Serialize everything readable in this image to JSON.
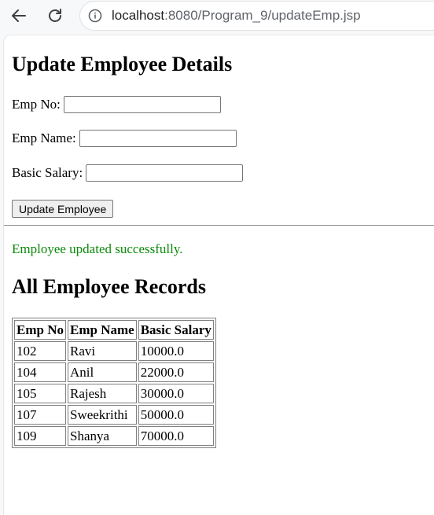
{
  "browser": {
    "url_host": "localhost",
    "url_rest": ":8080/Program_9/updateEmp.jsp"
  },
  "page": {
    "title": "Update Employee Details",
    "form": {
      "empno_label": "Emp No:",
      "empno_value": "",
      "empname_label": "Emp Name:",
      "empname_value": "",
      "salary_label": "Basic Salary:",
      "salary_value": "",
      "submit_label": "Update Employee"
    },
    "message": "Employee updated successfully.",
    "message_color": "#0a8a0a",
    "records_title": "All Employee Records",
    "table": {
      "headers": [
        "Emp No",
        "Emp Name",
        "Basic Salary"
      ],
      "rows": [
        [
          "102",
          "Ravi",
          "10000.0"
        ],
        [
          "104",
          "Anil",
          "22000.0"
        ],
        [
          "105",
          "Rajesh",
          "30000.0"
        ],
        [
          "107",
          "Sweekrithi",
          "50000.0"
        ],
        [
          "109",
          "Shanya",
          "70000.0"
        ]
      ]
    }
  }
}
